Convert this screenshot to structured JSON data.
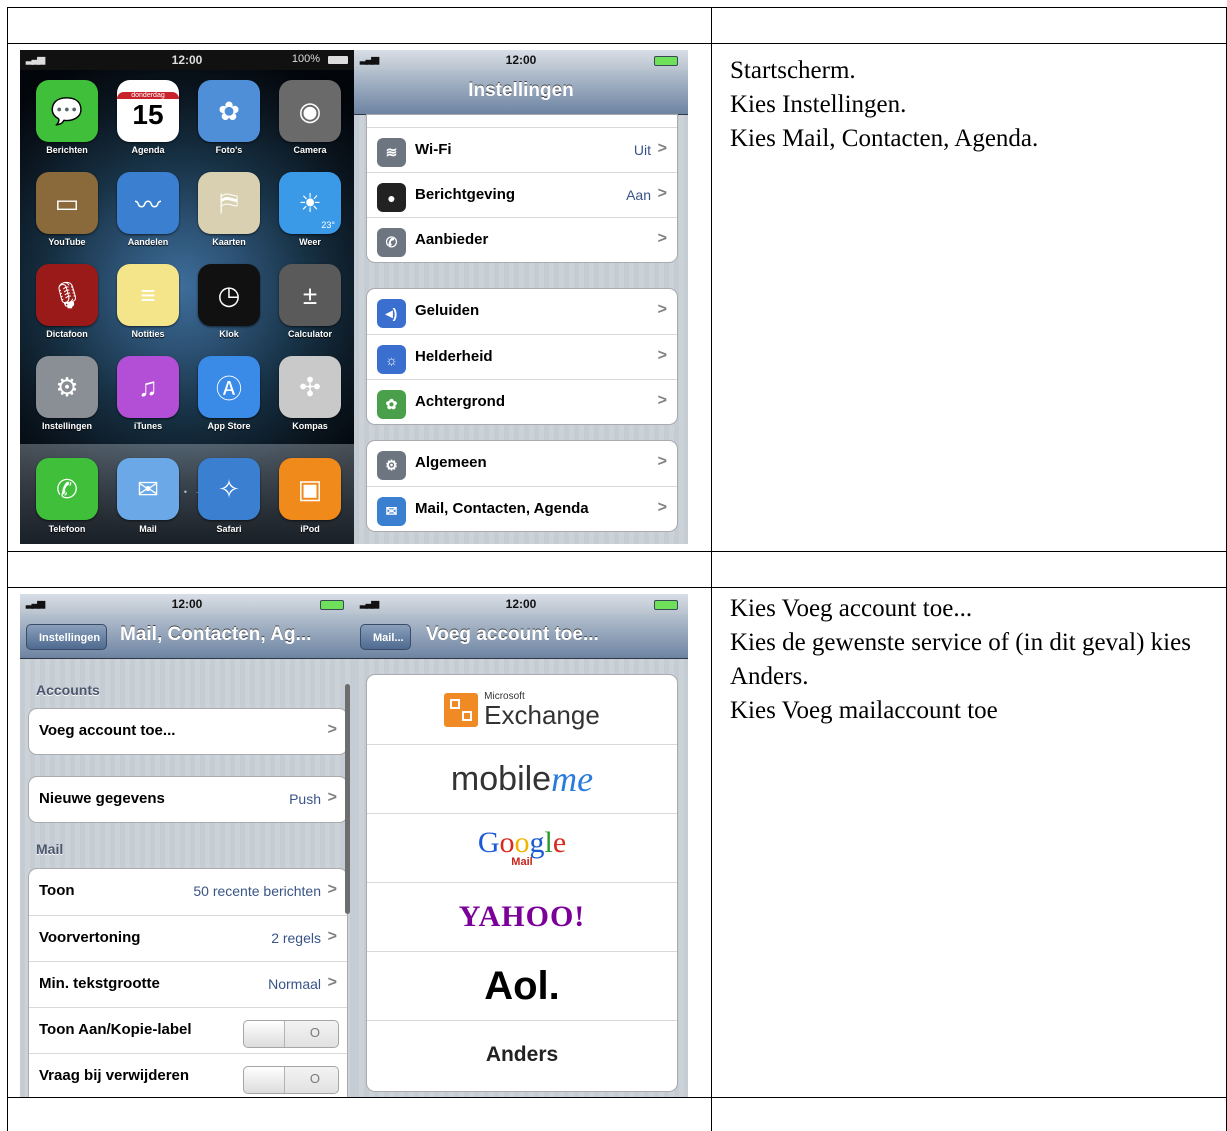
{
  "step1": {
    "home": {
      "status": {
        "time": "12:00",
        "battery": "100%"
      },
      "apps": [
        {
          "name": "Berichten",
          "icon": "messages-icon",
          "color": "#3fbf3a"
        },
        {
          "name": "Agenda",
          "icon": "calendar-icon",
          "color": "#ffffff",
          "day": "donderdag",
          "date": "15"
        },
        {
          "name": "Foto's",
          "icon": "photos-icon",
          "color": "#4f8fd8"
        },
        {
          "name": "Camera",
          "icon": "camera-icon",
          "color": "#6a6a6a"
        },
        {
          "name": "YouTube",
          "icon": "youtube-icon",
          "color": "#8a6a3a"
        },
        {
          "name": "Aandelen",
          "icon": "stocks-icon",
          "color": "#3a7fd0"
        },
        {
          "name": "Kaarten",
          "icon": "maps-icon",
          "color": "#d8d0b0"
        },
        {
          "name": "Weer",
          "icon": "weather-icon",
          "color": "#3a9ae8",
          "temp": "23°"
        },
        {
          "name": "Dictafoon",
          "icon": "voice-memos-icon",
          "color": "#9a1a1a"
        },
        {
          "name": "Notities",
          "icon": "notes-icon",
          "color": "#f5e58a"
        },
        {
          "name": "Klok",
          "icon": "clock-icon",
          "color": "#111111"
        },
        {
          "name": "Calculator",
          "icon": "calculator-icon",
          "color": "#5a5a5a"
        },
        {
          "name": "Instellingen",
          "icon": "settings-gear-icon",
          "color": "#8a8f96"
        },
        {
          "name": "iTunes",
          "icon": "itunes-icon",
          "color": "#b34fd6"
        },
        {
          "name": "App Store",
          "icon": "app-store-icon",
          "color": "#3a8ae8"
        },
        {
          "name": "Kompas",
          "icon": "compass-icon",
          "color": "#c9c9c9"
        }
      ],
      "dock": [
        {
          "name": "Telefoon",
          "icon": "phone-icon",
          "color": "#3fbf3a"
        },
        {
          "name": "Mail",
          "icon": "mail-icon",
          "color": "#6aa8e8"
        },
        {
          "name": "Safari",
          "icon": "safari-icon",
          "color": "#3a7fd0"
        },
        {
          "name": "iPod",
          "icon": "ipod-icon",
          "color": "#f08a1a"
        }
      ]
    },
    "settings": {
      "status": {
        "time": "12:00"
      },
      "title": "Instellingen",
      "groups": [
        [
          {
            "label": "Wi-Fi",
            "value": "Uit",
            "icon": "wifi-icon",
            "color": "#6d7680"
          },
          {
            "label": "Berichtgeving",
            "value": "Aan",
            "icon": "notifications-icon",
            "color": "#222222"
          },
          {
            "label": "Aanbieder",
            "value": "",
            "icon": "carrier-phone-icon",
            "color": "#6d7680"
          }
        ],
        [
          {
            "label": "Geluiden",
            "value": "",
            "icon": "sounds-icon",
            "color": "#3a6fd0"
          },
          {
            "label": "Helderheid",
            "value": "",
            "icon": "brightness-icon",
            "color": "#3a6fd0"
          },
          {
            "label": "Achtergrond",
            "value": "",
            "icon": "wallpaper-icon",
            "color": "#4aa04a"
          }
        ],
        [
          {
            "label": "Algemeen",
            "value": "",
            "icon": "general-gear-icon",
            "color": "#6d7680"
          },
          {
            "label": "Mail, Contacten, Agenda",
            "value": "",
            "icon": "mail-icon",
            "color": "#3a7fd0"
          }
        ]
      ]
    },
    "instructions": [
      "Startscherm.",
      "Kies Instellingen.",
      "Kies Mail, Contacten,  Agenda."
    ]
  },
  "step2": {
    "mail": {
      "status": {
        "time": "12:00"
      },
      "back": "Instellingen",
      "title": "Mail, Contacten, Ag...",
      "accounts_header": "Accounts",
      "add_account": "Voeg account toe...",
      "fetch": {
        "label": "Nieuwe gegevens",
        "value": "Push"
      },
      "mail_header": "Mail",
      "rows": [
        {
          "label": "Toon",
          "value": "50 recente berichten"
        },
        {
          "label": "Voorvertoning",
          "value": "2 regels"
        },
        {
          "label": "Min. tekstgrootte",
          "value": "Normaal"
        }
      ],
      "toggles": [
        {
          "label": "Toon Aan/Kopie-label",
          "state": "O"
        },
        {
          "label": "Vraag bij verwijderen",
          "state": "O"
        }
      ]
    },
    "add": {
      "status": {
        "time": "12:00"
      },
      "back": "Mail...",
      "title": "Voeg account toe...",
      "providers": {
        "exchange_small": "Microsoft",
        "exchange": "Exchange",
        "mobileme_a": "mobile",
        "mobileme_b": "me",
        "google": [
          "G",
          "o",
          "o",
          "g",
          "l",
          "e"
        ],
        "google_mail": "Mail",
        "yahoo": "YAHOO!",
        "aol": "Aol.",
        "other": "Anders"
      }
    },
    "instructions": [
      "Kies Voeg account toe...",
      "Kies de gewenste service of (in dit geval) kies Anders.",
      "Kies Voeg mailaccount toe"
    ]
  }
}
